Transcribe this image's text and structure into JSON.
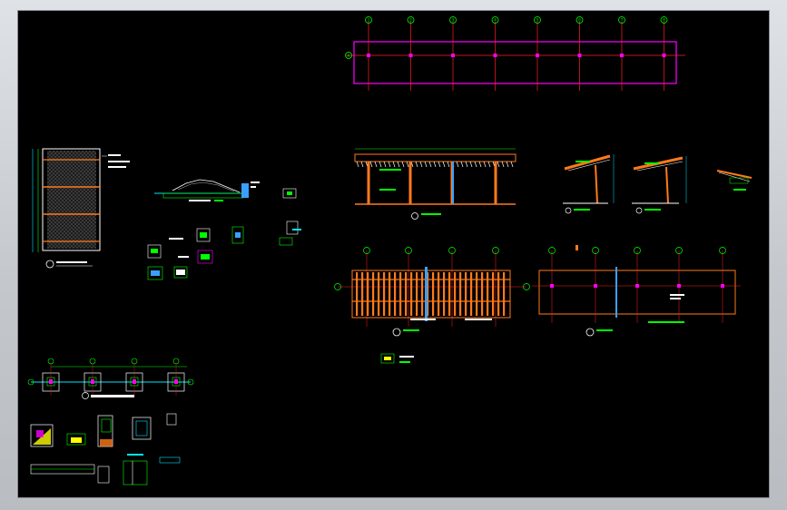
{
  "drawing": {
    "top_grid_axis_bubbles": [
      "1",
      "2",
      "3",
      "4",
      "5",
      "6",
      "7",
      "8"
    ],
    "top_grid_row_bubble": "A",
    "colors": {
      "background": "#000000",
      "grid_line": "#ff2020",
      "outline_magenta": "#ff00ff",
      "timber_orange": "#ff7a1a",
      "annotation_green": "#00ff00",
      "dimension_cyan": "#00e5ff",
      "text_white": "#ffffff",
      "steel_blue": "#3aa0ff",
      "highlight_yellow": "#ffff00"
    }
  }
}
